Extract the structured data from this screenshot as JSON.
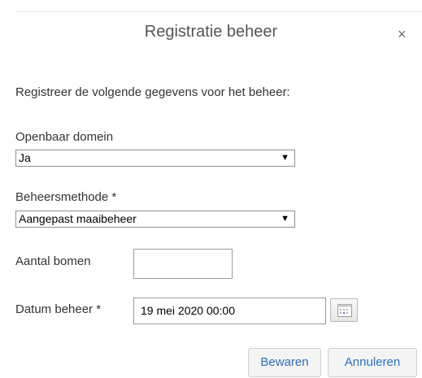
{
  "dialog": {
    "title": "Registratie beheer",
    "close_symbol": "×",
    "intro": "Registreer de volgende gegevens voor het beheer:"
  },
  "fields": {
    "openbaar_domein": {
      "label": "Openbaar domein",
      "value": "Ja"
    },
    "beheersmethode": {
      "label": "Beheersmethode *",
      "value": "Aangepast maaibeheer"
    },
    "aantal_bomen": {
      "label": "Aantal bomen",
      "value": ""
    },
    "datum_beheer": {
      "label": "Datum beheer *",
      "value": "19 mei 2020 00:00"
    }
  },
  "buttons": {
    "save": "Bewaren",
    "cancel": "Annuleren"
  },
  "icons": {
    "dropdown": "▼",
    "calendar": "calendar-icon"
  },
  "colors": {
    "button_text": "#2f6fb6",
    "calendar_dots": "#4a7fc1"
  }
}
